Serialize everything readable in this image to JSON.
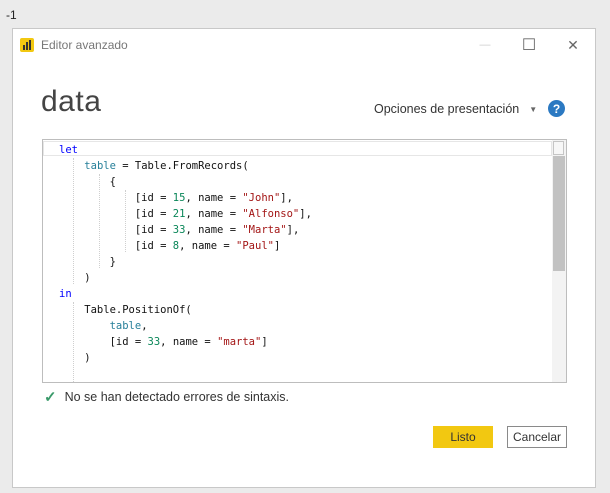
{
  "outside_label": "-1",
  "window": {
    "title": "Editor avanzado",
    "controls": {
      "minimize": "—",
      "maximize": "☐",
      "close": "✕"
    }
  },
  "header": {
    "query_name": "data",
    "display_options_label": "Opciones de presentación",
    "help_label": "?"
  },
  "code_lines": [
    [
      {
        "t": "let",
        "c": "kw"
      }
    ],
    [
      {
        "t": "    "
      },
      {
        "t": "table",
        "c": "id"
      },
      {
        "t": " = Table.FromRecords("
      }
    ],
    [
      {
        "t": "        {"
      }
    ],
    [
      {
        "t": "            [id = "
      },
      {
        "t": "15",
        "c": "num"
      },
      {
        "t": ", name = "
      },
      {
        "t": "\"John\"",
        "c": "str"
      },
      {
        "t": "],"
      }
    ],
    [
      {
        "t": "            [id = "
      },
      {
        "t": "21",
        "c": "num"
      },
      {
        "t": ", name = "
      },
      {
        "t": "\"Alfonso\"",
        "c": "str"
      },
      {
        "t": "],"
      }
    ],
    [
      {
        "t": "            [id = "
      },
      {
        "t": "33",
        "c": "num"
      },
      {
        "t": ", name = "
      },
      {
        "t": "\"Marta\"",
        "c": "str"
      },
      {
        "t": "],"
      }
    ],
    [
      {
        "t": "            [id = "
      },
      {
        "t": "8",
        "c": "num"
      },
      {
        "t": ", name = "
      },
      {
        "t": "\"Paul\"",
        "c": "str"
      },
      {
        "t": "]"
      }
    ],
    [
      {
        "t": "        }"
      }
    ],
    [
      {
        "t": "    )"
      }
    ],
    [
      {
        "t": "in",
        "c": "kw"
      }
    ],
    [
      {
        "t": "    Table.PositionOf("
      }
    ],
    [
      {
        "t": "        "
      },
      {
        "t": "table",
        "c": "id"
      },
      {
        "t": ","
      }
    ],
    [
      {
        "t": "        [id = "
      },
      {
        "t": "33",
        "c": "num"
      },
      {
        "t": ", name = "
      },
      {
        "t": "\"marta\"",
        "c": "str"
      },
      {
        "t": "]"
      }
    ],
    [
      {
        "t": "    )"
      }
    ]
  ],
  "status": {
    "message": "No se han detectado errores de sintaxis."
  },
  "buttons": {
    "done": "Listo",
    "cancel": "Cancelar"
  },
  "colors": {
    "accent": "#f2c811",
    "keyword": "#0000ff",
    "identifier": "#267f99",
    "number": "#098658",
    "string": "#a31515",
    "success": "#3a9a6a",
    "help": "#2b79c2"
  }
}
